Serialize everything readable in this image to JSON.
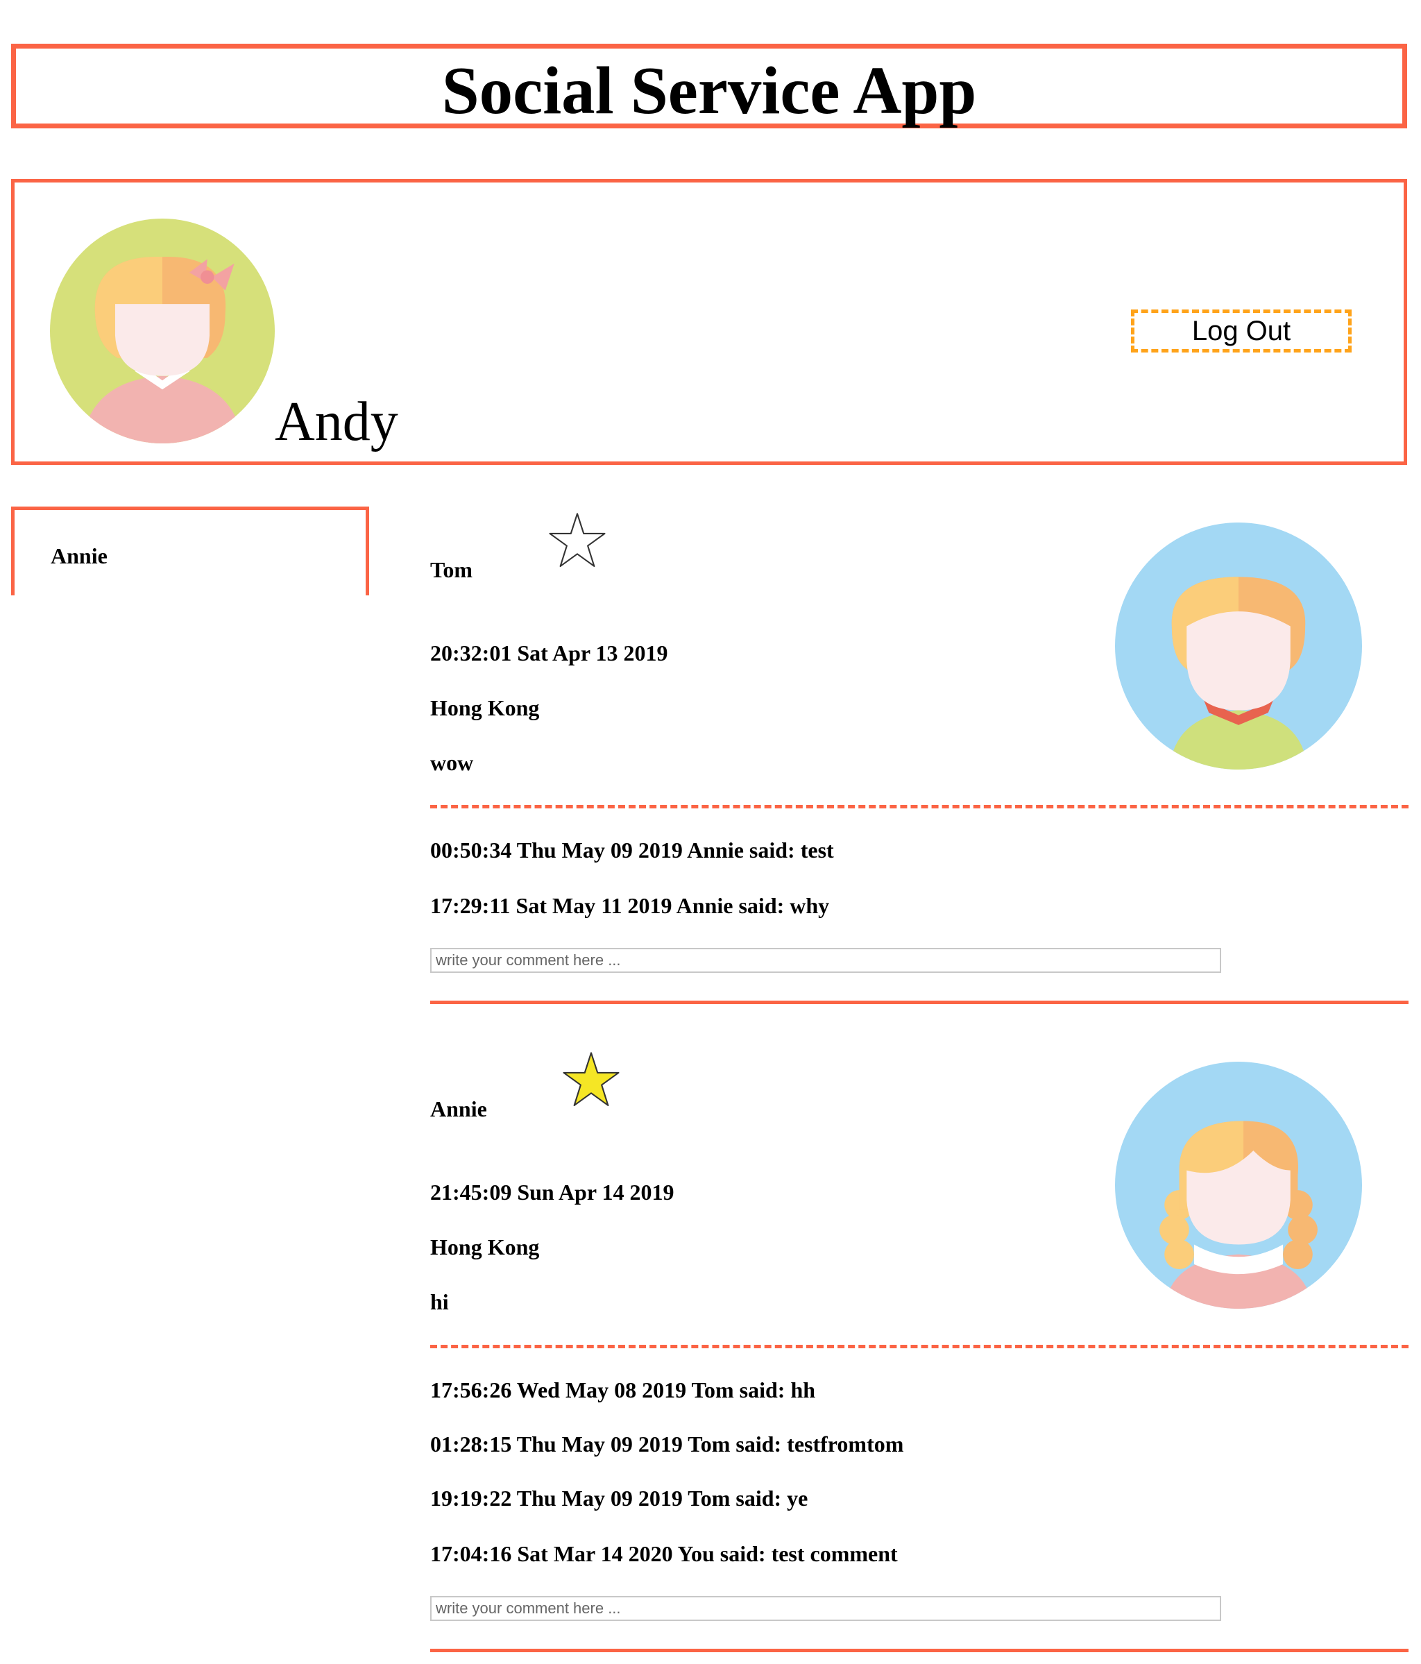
{
  "header": {
    "title": "Social Service App"
  },
  "profile": {
    "name": "Andy",
    "avatar_icon": "girl-with-bow-avatar-icon",
    "logout_label": "Log Out"
  },
  "sidebar": {
    "items": [
      {
        "label": "Annie"
      }
    ]
  },
  "posts": [
    {
      "author": "Tom",
      "starred": false,
      "timestamp": "20:32:01 Sat Apr 13 2019",
      "location": "Hong Kong",
      "content": "wow",
      "avatar_icon": "short-hair-avatar-icon",
      "comments": [
        "00:50:34 Thu May 09 2019 Annie said: test",
        "17:29:11 Sat May 11 2019 Annie said: why"
      ],
      "comment_placeholder": "write your comment here ..."
    },
    {
      "author": "Annie",
      "starred": true,
      "timestamp": "21:45:09 Sun Apr 14 2019",
      "location": "Hong Kong",
      "content": "hi",
      "avatar_icon": "curly-hair-avatar-icon",
      "comments": [
        "17:56:26 Wed May 08 2019 Tom said: hh",
        "01:28:15 Thu May 09 2019 Tom said: testfromtom",
        "19:19:22 Thu May 09 2019 Tom said: ye",
        "17:04:16 Sat Mar 14 2020 You said: test comment"
      ],
      "comment_placeholder": "write your comment here ..."
    }
  ],
  "colors": {
    "accent": "#fb6445",
    "logout_border": "#ffa31a",
    "star_fill": "#f5e625"
  }
}
